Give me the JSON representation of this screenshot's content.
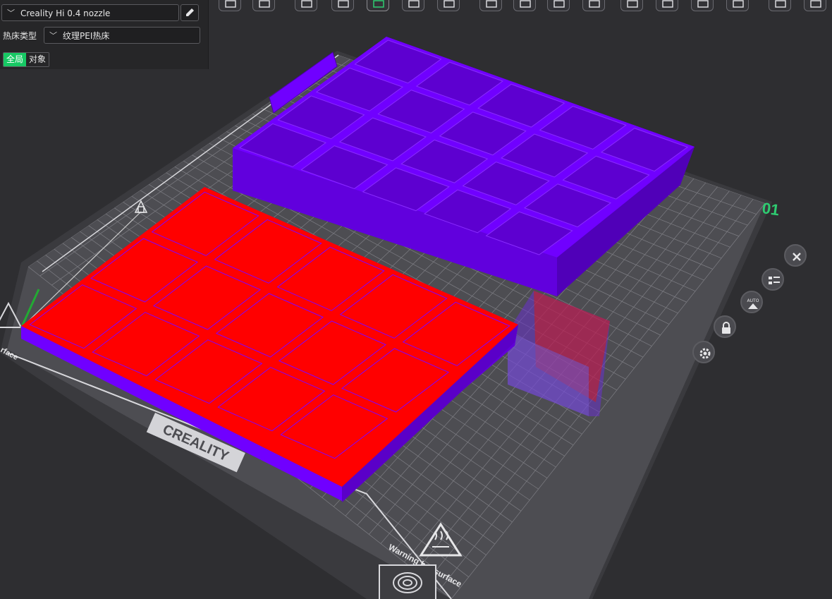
{
  "panel": {
    "printer": {
      "value": "Creality Hi 0.4 nozzle",
      "chevron_icon": "chevron-down-icon",
      "edit_icon": "pencil-icon"
    },
    "bed_type": {
      "label": "热床类型",
      "value": "纹理PEI热床",
      "chevron_icon": "chevron-down-icon"
    },
    "scope_tabs": [
      {
        "label": "全局",
        "active": true
      },
      {
        "label": "对象",
        "active": false
      }
    ]
  },
  "toolbar": {
    "icons": [
      "cube-view-icon",
      "grid-view-icon",
      "add-part-icon",
      "remove-part-icon",
      "slice-plate-icon",
      "arrange-icon",
      "export-icon",
      "layout-icon",
      "settings-gear-icon",
      "measure-icon",
      "layers-icon",
      "camera-icon",
      "edit-tool-icon",
      "add-tool-icon",
      "align-icon",
      "support-icon",
      "wrench-icon"
    ]
  },
  "plate": {
    "brand": "CREALITY",
    "plate_number": "01",
    "warning_text": "Warning hot surface",
    "accent": "#2ecc71",
    "side_text": "rface",
    "icons": [
      "hot-surface-warning-icon",
      "fingerprint-icon"
    ]
  },
  "plate_controls": [
    {
      "name": "close-plate-button",
      "icon": "close-icon"
    },
    {
      "name": "arrange-list-button",
      "icon": "list-icon"
    },
    {
      "name": "auto-orient-button",
      "icon": "auto-orient-icon",
      "label": "AUTO"
    },
    {
      "name": "lock-plate-button",
      "icon": "lock-icon"
    },
    {
      "name": "plate-settings-button",
      "icon": "gear-icon"
    }
  ],
  "colors": {
    "background": "#2e2e31",
    "plate": "#4a4a4f",
    "grid_line": "#7a7a80",
    "purple_model": "#7000ff",
    "red_selected": "#ff0000",
    "active_tab": "#17c964"
  }
}
